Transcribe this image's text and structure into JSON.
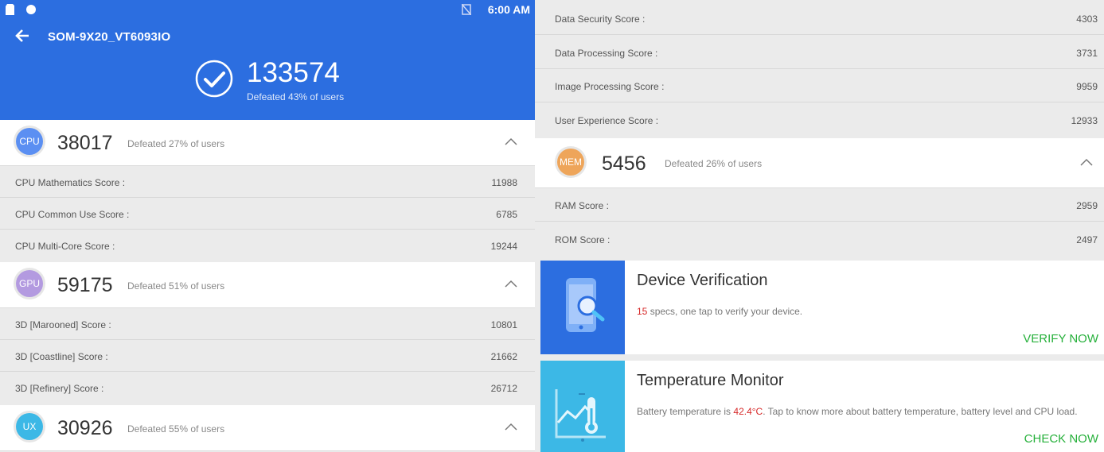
{
  "statusbar": {
    "time": "6:00 AM"
  },
  "header": {
    "device": "SOM-9X20_VT6093IO",
    "total_score": "133574",
    "total_defeated": "Defeated 43% of users"
  },
  "sections": {
    "cpu": {
      "badge": "CPU",
      "score": "38017",
      "defeated": "Defeated 27% of users",
      "color": "#5b8ff2",
      "rows": [
        {
          "label": "CPU Mathematics Score :",
          "value": "11988"
        },
        {
          "label": "CPU Common Use Score :",
          "value": "6785"
        },
        {
          "label": "CPU Multi-Core Score :",
          "value": "19244"
        }
      ]
    },
    "gpu": {
      "badge": "GPU",
      "score": "59175",
      "defeated": "Defeated 51% of users",
      "color": "#b39ae0",
      "rows": [
        {
          "label": "3D [Marooned] Score :",
          "value": "10801"
        },
        {
          "label": "3D [Coastline] Score :",
          "value": "21662"
        },
        {
          "label": "3D [Refinery] Score :",
          "value": "26712"
        }
      ]
    },
    "ux": {
      "badge": "UX",
      "score": "30926",
      "defeated": "Defeated 55% of users",
      "color": "#3cb8e6",
      "rows": [
        {
          "label": "Data Security Score :",
          "value": "4303"
        },
        {
          "label": "Data Processing Score :",
          "value": "3731"
        },
        {
          "label": "Image Processing Score :",
          "value": "9959"
        },
        {
          "label": "User Experience Score :",
          "value": "12933"
        }
      ]
    },
    "mem": {
      "badge": "MEM",
      "score": "5456",
      "defeated": "Defeated 26% of users",
      "color": "#eea55a",
      "rows": [
        {
          "label": "RAM Score :",
          "value": "2959"
        },
        {
          "label": "ROM Score :",
          "value": "2497"
        }
      ]
    }
  },
  "cards": {
    "verify": {
      "title": "Device Verification",
      "count": "15",
      "desc_rest": " specs, one tap to verify your device.",
      "action": "VERIFY NOW",
      "color": "#2c6ee0"
    },
    "temp": {
      "title": "Temperature Monitor",
      "desc_pre": "Battery temperature is ",
      "temp": "42.4°C",
      "desc_post": ". Tap to know more about battery temperature, battery level and CPU load.",
      "action": "CHECK NOW",
      "color": "#3cb8e6"
    }
  },
  "colors": {
    "accent": "#2c6ee0",
    "action_green": "#25b03a",
    "highlight_red": "#d62828"
  }
}
